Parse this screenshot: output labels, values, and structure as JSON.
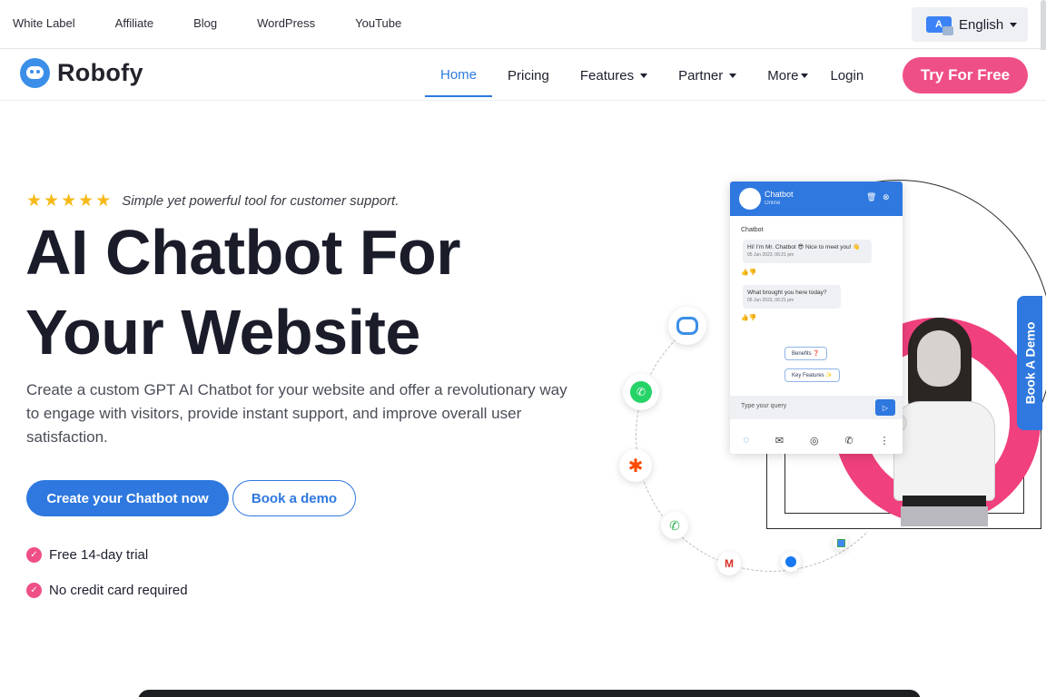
{
  "topbar": {
    "links": [
      "White Label",
      "Affiliate",
      "Blog",
      "WordPress",
      "YouTube"
    ],
    "language": {
      "flag_text": "A",
      "label": "English"
    }
  },
  "nav": {
    "brand": "Robofy",
    "items": [
      {
        "label": "Home",
        "active": true,
        "dropdown": false
      },
      {
        "label": "Pricing",
        "active": false,
        "dropdown": false
      },
      {
        "label": "Features",
        "active": false,
        "dropdown": true
      },
      {
        "label": "Partner",
        "active": false,
        "dropdown": true
      },
      {
        "label": "More",
        "active": false,
        "dropdown": true
      },
      {
        "label": "Login",
        "active": false,
        "dropdown": false
      }
    ],
    "cta": "Try For Free"
  },
  "hero": {
    "rating_stars": 5,
    "tagline": "Simple yet powerful tool for customer support.",
    "headline_line1": "AI Chatbot For",
    "headline_line2": "Your Website",
    "description": "Create a custom GPT AI Chatbot for your website and offer a revolutionary way to engage with visitors, provide instant support, and improve overall user satisfaction.",
    "primary_button": "Create your Chatbot now",
    "secondary_button": "Book a demo",
    "checks": [
      "Free 14-day trial",
      "No credit card required"
    ]
  },
  "chat_widget": {
    "title": "Chatbot",
    "status": "Online",
    "sender": "Chatbot",
    "messages": [
      {
        "text": "Hi! I'm Mr. Chatbot 😎 Nice to meet you! 👋",
        "time": "05 Jun 2023, 06:21 pm"
      },
      {
        "text": "What brought you here today?",
        "time": "05 Jun 2023, 06:21 pm"
      }
    ],
    "chips": [
      "Benefits ❓",
      "Key Features ✨"
    ],
    "input_placeholder": "Type your query"
  },
  "side_tab": "Book A Demo",
  "colors": {
    "primary_blue": "#2e78df",
    "accent_pink": "#ef4f87",
    "star_yellow": "#f6b91a"
  },
  "icons": [
    "robot-icon",
    "whatsapp-icon",
    "zapier-icon",
    "phone-icon",
    "gmail-icon",
    "messenger-icon",
    "calendar-icon"
  ]
}
